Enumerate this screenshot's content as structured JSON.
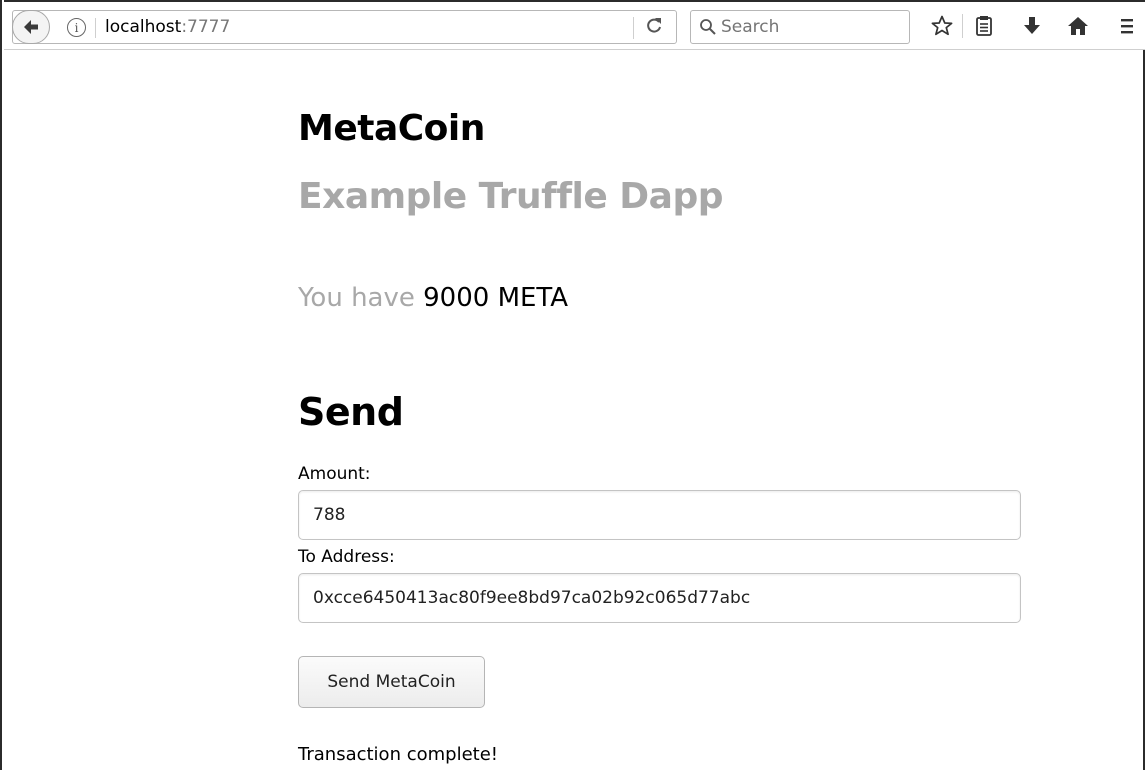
{
  "browser": {
    "url_host": "localhost",
    "url_port": ":7777",
    "search_placeholder": "Search"
  },
  "page": {
    "title": "MetaCoin",
    "subtitle": "Example Truffle Dapp",
    "balance_prefix": "You have",
    "balance_value": "9000 META",
    "send_heading": "Send",
    "amount_label": "Amount:",
    "amount_value": "788",
    "address_label": "To Address:",
    "address_value": "0xcce6450413ac80f9ee8bd97ca02b92c065d77abc",
    "send_button": "Send MetaCoin",
    "status": "Transaction complete!"
  },
  "icons": {
    "back": "arrow-left-icon",
    "info": "info-icon",
    "reload": "reload-icon",
    "search": "search-icon",
    "bookmark": "star-icon",
    "reading_list": "clipboard-icon",
    "downloads": "download-arrow-icon",
    "home": "home-icon",
    "menu": "hamburger-menu-icon"
  }
}
